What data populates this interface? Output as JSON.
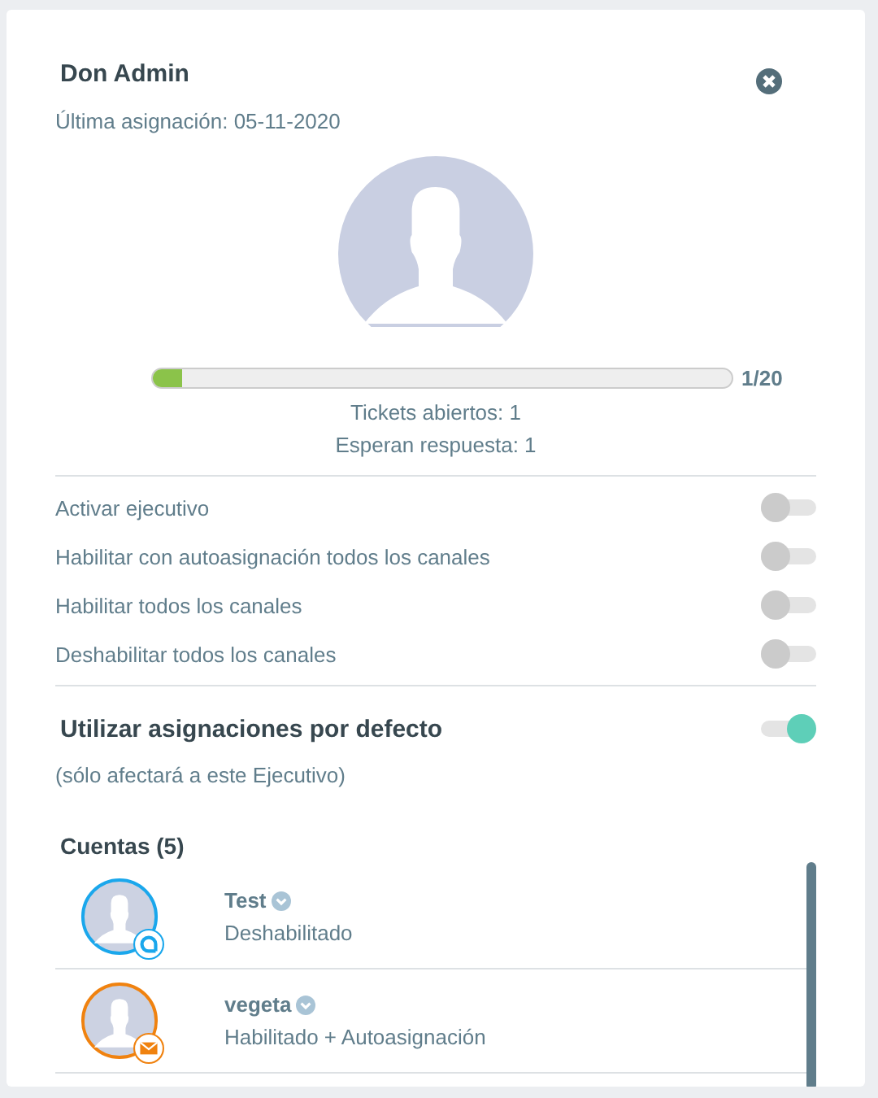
{
  "profile": {
    "name": "Don Admin",
    "last_assignment": "Última asignación: 05-11-2020",
    "load": {
      "level": 0.05,
      "reading": "1/20"
    },
    "open_tickets": "Tickets abiertos: 1",
    "awaiting_reply": "Esperan respuesta: 1"
  },
  "toggles": [
    {
      "label": "Activar ejecutivo",
      "on": false
    },
    {
      "label": "Habilitar con autoasignación todos los canales",
      "on": false
    },
    {
      "label": "Habilitar todos los canales",
      "on": false
    },
    {
      "label": "Deshabilitar todos los canales",
      "on": false
    }
  ],
  "default_assignments": {
    "label": "Utilizar asignaciones por defecto",
    "on": true,
    "note": "(sólo afectará a este Ejecutivo)"
  },
  "accounts": {
    "title": "Cuentas (5)",
    "items": [
      {
        "name": "Test",
        "status": "Deshabilitado",
        "kind": "chat",
        "color": "#1aa7ec"
      },
      {
        "name": "vegeta",
        "status": "Habilitado + Autoasignación",
        "kind": "email",
        "color": "#f0820f"
      }
    ]
  }
}
